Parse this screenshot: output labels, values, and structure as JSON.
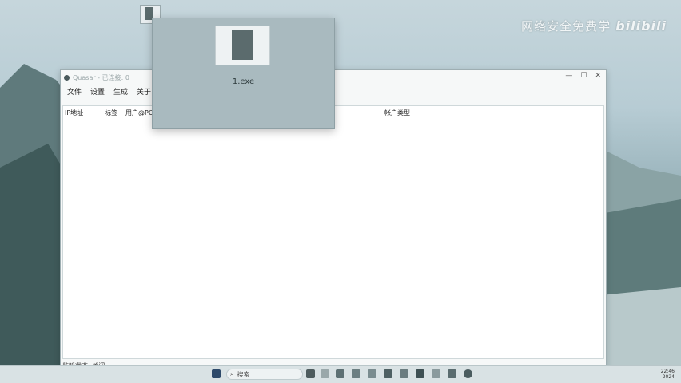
{
  "watermark": {
    "text": "网络安全免费学",
    "logo": "bilibili"
  },
  "desktop": {
    "icon_name": "document-icon"
  },
  "window": {
    "title": "Quasar - 已连接: 0",
    "menu": [
      "文件",
      "设置",
      "生成",
      "关于"
    ],
    "columns": [
      "IP地址",
      "标签",
      "用户@PC",
      "帐户类型"
    ],
    "status": "监听状态: 关闭",
    "controls": {
      "minimize": "—",
      "maximize": "☐",
      "close": "✕"
    }
  },
  "preview": {
    "label": "1.exe"
  },
  "taskbar": {
    "search_placeholder": "搜索",
    "tray_time": "22:46",
    "tray_date": "2024",
    "icons": [
      "windows-start-icon",
      "search-icon",
      "bike-widget-icon",
      "app-icon",
      "file-explorer-icon",
      "browser-icon",
      "chat-icon",
      "store-icon",
      "terminal-icon",
      "settings-icon",
      "edge-icon",
      "quasar-icon",
      "notepad-icon",
      "app-icon"
    ]
  }
}
